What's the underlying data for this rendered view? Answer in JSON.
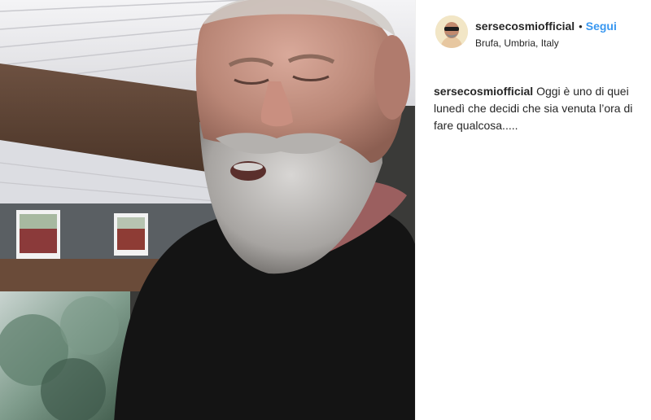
{
  "post": {
    "media": {
      "type": "video",
      "description_icon": "video-frame"
    },
    "author": {
      "username": "sersecosmiofficial",
      "separator": "•",
      "follow_label": "Segui",
      "location": "Brufa, Umbria, Italy",
      "avatar_icon": "avatar-portrait"
    },
    "caption": {
      "username": "sersecosmiofficial",
      "text": "Oggi è uno di quei lunedì che decidi che sia venuta l’ora di fare qualcosa....."
    }
  },
  "colors": {
    "link": "#3897f0",
    "text": "#262626",
    "border": "#efefef",
    "background": "#ffffff"
  }
}
